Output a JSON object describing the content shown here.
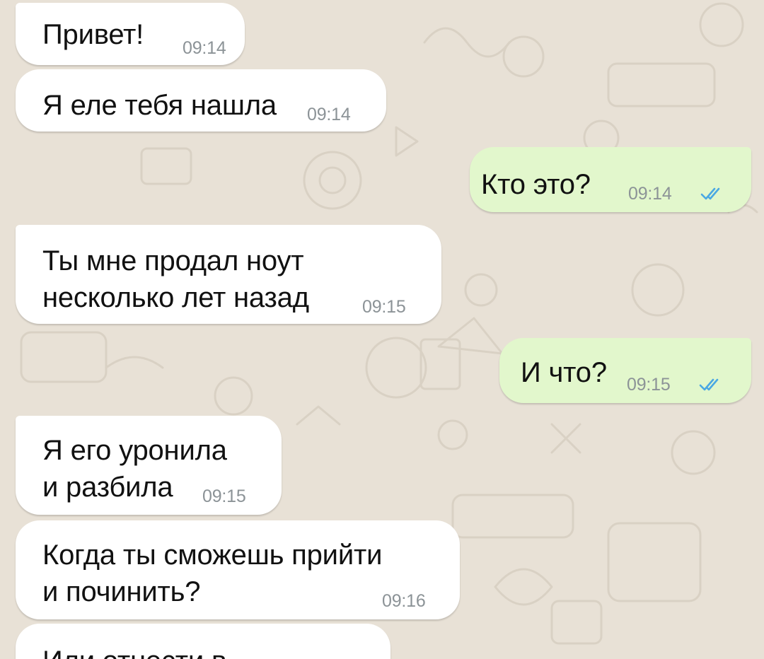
{
  "colors": {
    "wallpaper": "#e8e1d6",
    "incoming_bubble": "#ffffff",
    "outgoing_bubble": "#e2f7cc",
    "timestamp": "#8c9397",
    "read_ticks": "#4aa8e3"
  },
  "messages": [
    {
      "direction": "incoming",
      "lines": [
        "Привет!"
      ],
      "time": "09:14"
    },
    {
      "direction": "incoming",
      "lines": [
        "Я еле тебя нашла"
      ],
      "time": "09:14"
    },
    {
      "direction": "outgoing",
      "lines": [
        "Кто это?"
      ],
      "time": "09:14",
      "status_icon": "double-check-icon"
    },
    {
      "direction": "incoming",
      "lines": [
        "Ты мне продал ноут",
        "несколько лет назад"
      ],
      "time": "09:15"
    },
    {
      "direction": "outgoing",
      "lines": [
        "И что?"
      ],
      "time": "09:15",
      "status_icon": "double-check-icon"
    },
    {
      "direction": "incoming",
      "lines": [
        "Я его уронила",
        "и разбила"
      ],
      "time": "09:15"
    },
    {
      "direction": "incoming",
      "lines": [
        "Когда ты сможешь прийти",
        "и починить?"
      ],
      "time": "09:16"
    },
    {
      "direction": "incoming",
      "lines": [
        "Или отнести в"
      ],
      "time": ""
    }
  ]
}
